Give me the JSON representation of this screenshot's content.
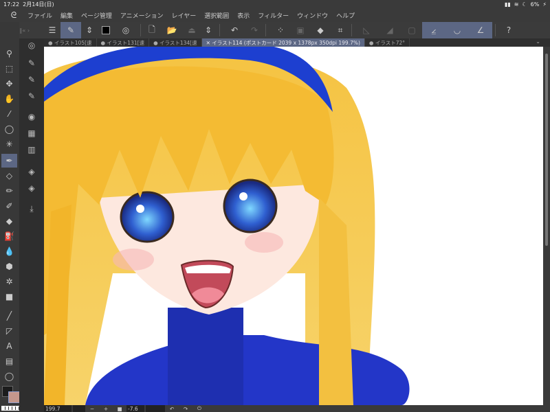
{
  "status": {
    "time": "17:22",
    "date": "2月14日(日)",
    "battery": "6%"
  },
  "menu": [
    "ファイル",
    "編集",
    "ページ管理",
    "アニメーション",
    "レイヤー",
    "選択範囲",
    "表示",
    "フィルター",
    "ウィンドウ",
    "ヘルプ"
  ],
  "tabs": [
    {
      "label": "● イラスト105[速"
    },
    {
      "label": "● イラスト131[速"
    },
    {
      "label": "● イラスト134[速"
    },
    {
      "label": "✕ イラスト114 (ポストカード 2039 x 1378px 350dpi 199.7%)",
      "active": true
    },
    {
      "label": "● イラスト72°"
    }
  ],
  "bottom": {
    "zoom": "199.7",
    "rotation": "-7.6",
    "minus": "−",
    "plus": "+"
  },
  "colors": {
    "accent": "#5c6784",
    "main_color": "#1c1c1c",
    "sub_color": "#c4978c"
  }
}
